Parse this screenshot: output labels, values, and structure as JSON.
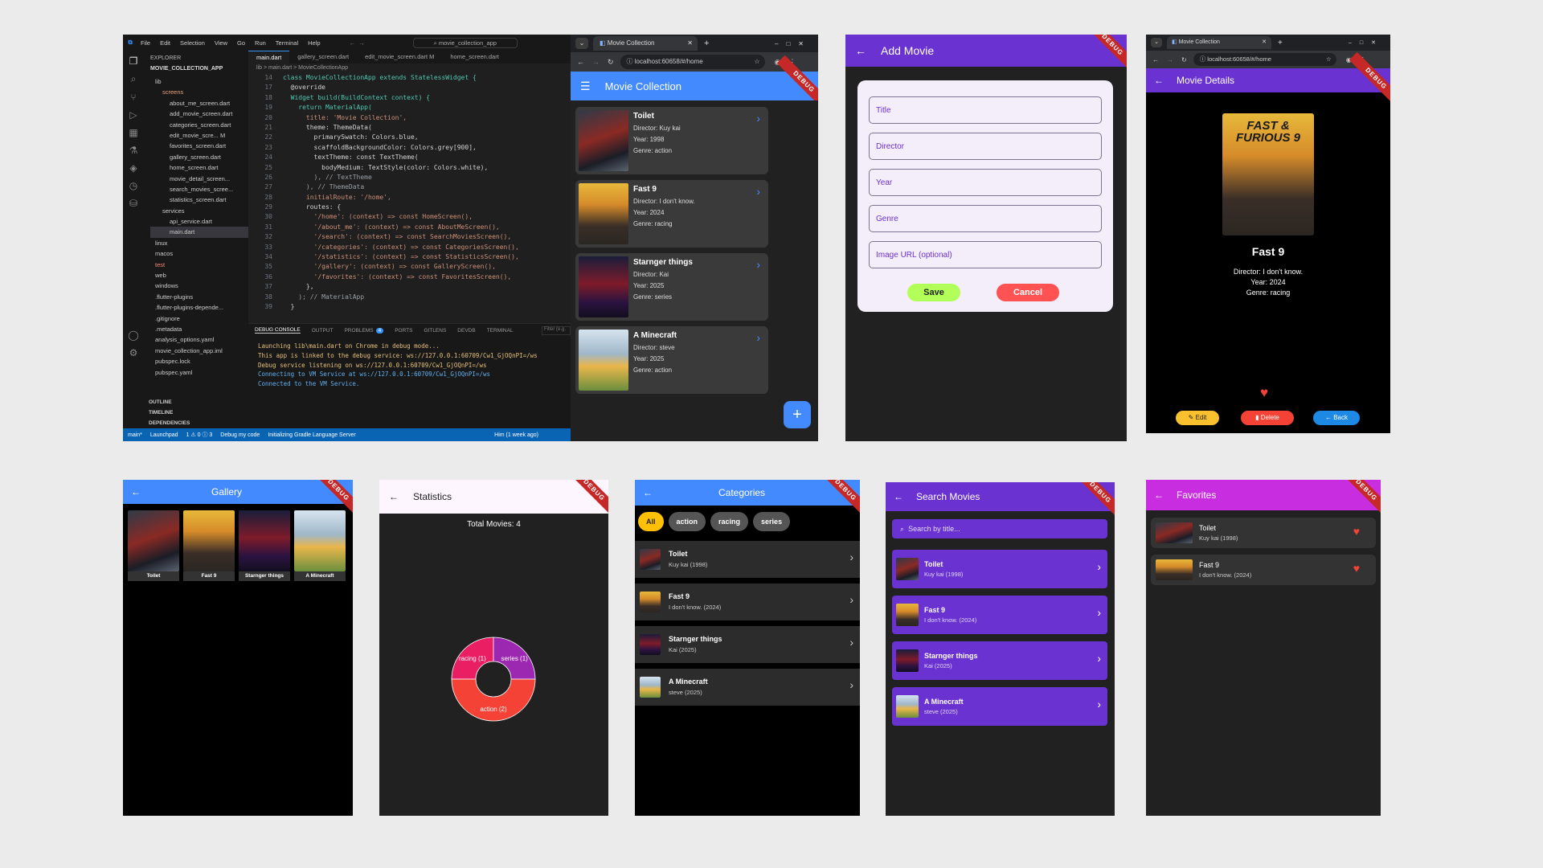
{
  "vscode": {
    "menu": [
      "File",
      "Edit",
      "Selection",
      "View",
      "Go",
      "Run",
      "Terminal",
      "Help"
    ],
    "search": "movie_collection_app",
    "tabs": [
      "main.dart",
      "gallery_screen.dart",
      "edit_movie_screen.dart M",
      "home_screen.dart"
    ],
    "explorer_title": "EXPLORER",
    "project": "MOVIE_COLLECTION_APP",
    "tree": [
      "lib",
      "screens",
      "about_me_screen.dart",
      "add_movie_screen.dart",
      "categories_screen.dart",
      "edit_movie_scre...   M",
      "favorites_screen.dart",
      "gallery_screen.dart",
      "home_screen.dart",
      "movie_detail_screen...",
      "search_movies_scree...",
      "statistics_screen.dart",
      "services",
      "api_service.dart",
      "main.dart",
      "linux",
      "macos",
      "test",
      "web",
      "windows",
      ".flutter-plugins",
      ".flutter-plugins-depende...",
      ".gitignore",
      ".metadata",
      "analysis_options.yaml",
      "movie_collection_app.iml",
      "pubspec.lock",
      "pubspec.yaml"
    ],
    "outline": [
      "OUTLINE",
      "TIMELINE",
      "DEPENDENCIES"
    ],
    "breadcrumb": "lib > main.dart > MovieCollectionApp",
    "line_numbers": [
      "14",
      "17",
      "18",
      "19",
      "20",
      "21",
      "22",
      "23",
      "24",
      "25",
      "26",
      "27",
      "28",
      "29",
      "30",
      "31",
      "32",
      "33",
      "34",
      "35",
      "36",
      "37",
      "38",
      "39"
    ],
    "code": [
      "class MovieCollectionApp extends StatelessWidget {",
      "  @override",
      "  Widget build(BuildContext context) {",
      "    return MaterialApp(",
      "      title: 'Movie Collection',",
      "      theme: ThemeData(",
      "        primarySwatch: Colors.blue,",
      "        scaffoldBackgroundColor: Colors.grey[900],",
      "        textTheme: const TextTheme(",
      "          bodyMedium: TextStyle(color: Colors.white),",
      "        ), // TextTheme",
      "      ), // ThemeData",
      "      initialRoute: '/home',",
      "      routes: {",
      "        '/home': (context) => const HomeScreen(),",
      "        '/about_me': (context) => const AboutMeScreen(),",
      "        '/search': (context) => const SearchMoviesScreen(),",
      "        '/categories': (context) => const CategoriesScreen(),",
      "        '/statistics': (context) => const StatisticsScreen(),",
      "        '/gallery': (context) => const GalleryScreen(),",
      "        '/favorites': (context) => const FavoritesScreen(),",
      "      },",
      "    ); // MaterialApp",
      "  }"
    ],
    "panel_tabs": [
      "DEBUG CONSOLE",
      "OUTPUT",
      "PROBLEMS",
      "PORTS",
      "GITLENS",
      "DEVDB",
      "TERMINAL"
    ],
    "problems_count": "4",
    "filter": "Filter (e.g.",
    "terminal": [
      "Launching lib\\main.dart on Chrome in debug mode...",
      "This app is linked to the debug service: ws://127.0.0.1:60709/Cw1_GjOQnPI=/ws",
      "Debug service listening on ws://127.0.0.1:60709/Cw1_GjOQnPI=/ws",
      "Connecting to VM Service at ws://127.0.0.1:60709/Cw1_GjOQnPI=/ws",
      "Connected to the VM Service."
    ],
    "status": [
      "main*",
      "Launchpad",
      "1 ⚠ 0 ⓘ 3",
      "Debug my code",
      "Initializing Gradle Language Server",
      "Him (1 week ago)"
    ]
  },
  "browser1": {
    "tab": "Movie Collection",
    "url": "localhost:60658/#/home"
  },
  "home": {
    "title": "Movie Collection",
    "movies": [
      {
        "title": "Toilet",
        "director": "Director: Kuy kai",
        "year": "Year: 1998",
        "genre": "Genre: action"
      },
      {
        "title": "Fast 9",
        "director": "Director: I don't know.",
        "year": "Year: 2024",
        "genre": "Genre: racing"
      },
      {
        "title": "Starnger things",
        "director": "Director: Kai",
        "year": "Year: 2025",
        "genre": "Genre: series"
      },
      {
        "title": "A Minecraft",
        "director": "Director: steve",
        "year": "Year: 2025",
        "genre": "Genre: action"
      }
    ],
    "fab": "+"
  },
  "add": {
    "title": "Add Movie",
    "fields": [
      "Title",
      "Director",
      "Year",
      "Genre",
      "Image URL (optional)"
    ],
    "save": "Save",
    "cancel": "Cancel"
  },
  "browser2": {
    "tab": "Movie Collection",
    "url": "localhost:60658/#/home"
  },
  "detail": {
    "title": "Movie Details",
    "poster_text": "FAST & FURIOUS 9",
    "movie": "Fast 9",
    "director": "Director: I don't know.",
    "year": "Year: 2024",
    "genre": "Genre: racing",
    "edit": "Edit",
    "delete": "Delete",
    "back": "Back"
  },
  "gallery": {
    "title": "Gallery",
    "items": [
      "Toilet",
      "Fast 9",
      "Starnger things",
      "A Minecraft"
    ]
  },
  "stats": {
    "title": "Statistics",
    "total": "Total Movies: 4",
    "slices": [
      {
        "label": "racing (1)",
        "value": 1,
        "color": "#e91e63"
      },
      {
        "label": "series (1)",
        "value": 1,
        "color": "#9c27b0"
      },
      {
        "label": "action (2)",
        "value": 2,
        "color": "#f44336"
      }
    ]
  },
  "categories": {
    "title": "Categories",
    "chips": [
      "All",
      "action",
      "racing",
      "series"
    ],
    "items": [
      {
        "title": "Toilet",
        "sub": "Kuy kai (1998)"
      },
      {
        "title": "Fast 9",
        "sub": "I don't know. (2024)"
      },
      {
        "title": "Starnger things",
        "sub": "Kai (2025)"
      },
      {
        "title": "A Minecraft",
        "sub": "steve (2025)"
      }
    ]
  },
  "search": {
    "title": "Search Movies",
    "placeholder": "Search by title...",
    "items": [
      {
        "title": "Toilet",
        "sub": "Kuy kai (1998)"
      },
      {
        "title": "Fast 9",
        "sub": "I don't know. (2024)"
      },
      {
        "title": "Starnger things",
        "sub": "Kai (2025)"
      },
      {
        "title": "A Minecraft",
        "sub": "steve (2025)"
      }
    ]
  },
  "favorites": {
    "title": "Favorites",
    "items": [
      {
        "title": "Toilet",
        "sub": "Kuy kai (1998)"
      },
      {
        "title": "Fast 9",
        "sub": "I don't know. (2024)"
      }
    ]
  },
  "debug_label": "DEBUG",
  "colors": {
    "blue": "#448aff",
    "purple": "#6a32d0",
    "magenta": "#c82ee0",
    "dark": "#222222",
    "card": "#3a3a3a"
  }
}
